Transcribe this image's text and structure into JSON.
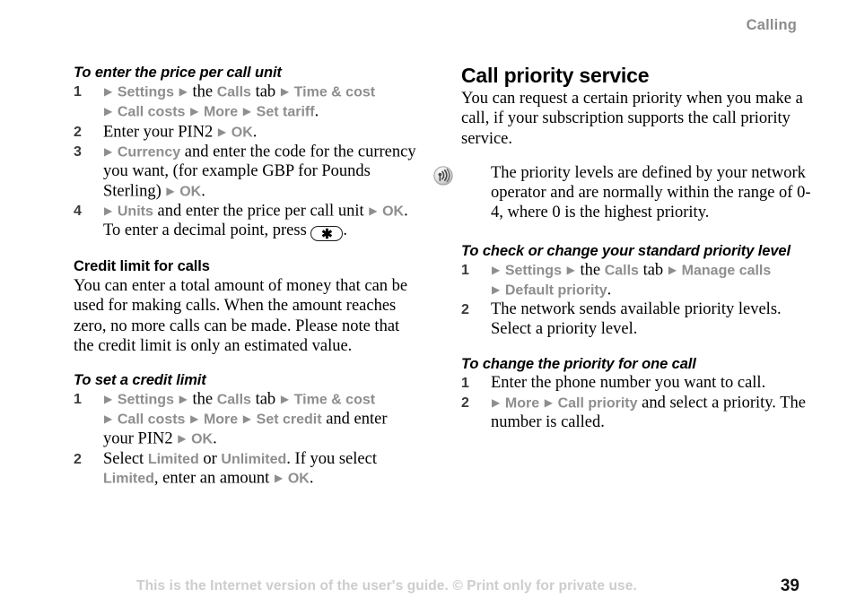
{
  "header": {
    "chapter": "Calling"
  },
  "left_column": {
    "section1": {
      "heading": "To enter the price per call unit",
      "steps": [
        {
          "num": "1",
          "lines": [
            [
              {
                "t": "arrow",
                "v": "▶"
              },
              {
                "t": "menu",
                "v": "Settings"
              },
              {
                "t": "arrow",
                "v": "▶"
              },
              {
                "t": "text",
                "v": "the"
              },
              {
                "t": "menu",
                "v": "Calls"
              },
              {
                "t": "text",
                "v": "tab"
              },
              {
                "t": "arrow",
                "v": "▶"
              },
              {
                "t": "menu",
                "v": "Time & cost"
              }
            ],
            [
              {
                "t": "arrow",
                "v": "▶"
              },
              {
                "t": "menu",
                "v": "Call costs"
              },
              {
                "t": "arrow",
                "v": "▶"
              },
              {
                "t": "menu",
                "v": "More"
              },
              {
                "t": "arrow",
                "v": "▶"
              },
              {
                "t": "menu",
                "v": "Set tariff"
              },
              {
                "t": "text",
                "v": "."
              }
            ]
          ]
        },
        {
          "num": "2",
          "lines": [
            [
              {
                "t": "text",
                "v": "Enter your PIN2"
              },
              {
                "t": "arrow",
                "v": "▶"
              },
              {
                "t": "menu",
                "v": "OK"
              },
              {
                "t": "text",
                "v": "."
              }
            ]
          ]
        },
        {
          "num": "3",
          "lines": [
            [
              {
                "t": "arrow",
                "v": "▶"
              },
              {
                "t": "menu",
                "v": "Currency"
              },
              {
                "t": "text",
                "v": "and enter the code for the currency you want, (for example GBP for Pounds Sterling)"
              },
              {
                "t": "arrow",
                "v": "▶"
              },
              {
                "t": "menu",
                "v": "OK"
              },
              {
                "t": "text",
                "v": "."
              }
            ]
          ]
        },
        {
          "num": "4",
          "lines": [
            [
              {
                "t": "arrow",
                "v": "▶"
              },
              {
                "t": "menu",
                "v": "Units"
              },
              {
                "t": "text",
                "v": "and enter the price per call unit"
              },
              {
                "t": "arrow",
                "v": "▶"
              },
              {
                "t": "menu",
                "v": "OK"
              },
              {
                "t": "text",
                "v": ". To enter a decimal point, press"
              },
              {
                "t": "keycap",
                "v": "✱"
              },
              {
                "t": "text",
                "v": "."
              }
            ]
          ]
        }
      ]
    },
    "section2": {
      "heading": "Credit limit for calls",
      "body": "You can enter a total amount of money that can be used for making calls. When the amount reaches zero, no more calls can be made. Please note that the credit limit is only an estimated value."
    },
    "section3": {
      "heading": "To set a credit limit",
      "steps": [
        {
          "num": "1",
          "lines": [
            [
              {
                "t": "arrow",
                "v": "▶"
              },
              {
                "t": "menu",
                "v": "Settings"
              },
              {
                "t": "arrow",
                "v": "▶"
              },
              {
                "t": "text",
                "v": "the"
              },
              {
                "t": "menu",
                "v": "Calls"
              },
              {
                "t": "text",
                "v": "tab"
              },
              {
                "t": "arrow",
                "v": "▶"
              },
              {
                "t": "menu",
                "v": "Time & cost"
              }
            ],
            [
              {
                "t": "arrow",
                "v": "▶"
              },
              {
                "t": "menu",
                "v": "Call costs"
              },
              {
                "t": "arrow",
                "v": "▶"
              },
              {
                "t": "menu",
                "v": "More"
              },
              {
                "t": "arrow",
                "v": "▶"
              },
              {
                "t": "menu",
                "v": "Set credit"
              },
              {
                "t": "text",
                "v": "and enter your PIN2"
              },
              {
                "t": "arrow",
                "v": "▶"
              },
              {
                "t": "menu",
                "v": "OK"
              },
              {
                "t": "text",
                "v": "."
              }
            ]
          ]
        },
        {
          "num": "2",
          "lines": [
            [
              {
                "t": "text",
                "v": "Select"
              },
              {
                "t": "menu",
                "v": "Limited"
              },
              {
                "t": "text",
                "v": "or"
              },
              {
                "t": "menu",
                "v": "Unlimited"
              },
              {
                "t": "text",
                "v": ". If you select"
              },
              {
                "t": "menu",
                "v": "Limited"
              },
              {
                "t": "text",
                "v": ", enter an amount"
              },
              {
                "t": "arrow",
                "v": "▶"
              },
              {
                "t": "menu",
                "v": "OK"
              },
              {
                "t": "text",
                "v": "."
              }
            ]
          ]
        }
      ]
    }
  },
  "right_column": {
    "section1": {
      "heading": "Call priority service",
      "body": "You can request a certain priority when you make a call, if your subscription supports the call priority service."
    },
    "note": {
      "icon": "network-signal-icon",
      "body": "The priority levels are defined by your network operator and are normally within the range of 0-4, where 0 is the highest priority."
    },
    "section2": {
      "heading": "To check or change your standard priority level",
      "steps": [
        {
          "num": "1",
          "lines": [
            [
              {
                "t": "arrow",
                "v": "▶"
              },
              {
                "t": "menu",
                "v": "Settings"
              },
              {
                "t": "arrow",
                "v": "▶"
              },
              {
                "t": "text",
                "v": "the"
              },
              {
                "t": "menu",
                "v": "Calls"
              },
              {
                "t": "text",
                "v": "tab"
              },
              {
                "t": "arrow",
                "v": "▶"
              },
              {
                "t": "menu",
                "v": "Manage calls"
              }
            ],
            [
              {
                "t": "arrow",
                "v": "▶"
              },
              {
                "t": "menu",
                "v": "Default priority"
              },
              {
                "t": "text",
                "v": "."
              }
            ]
          ]
        },
        {
          "num": "2",
          "lines": [
            [
              {
                "t": "text",
                "v": "The network sends available priority levels. Select a priority level."
              }
            ]
          ]
        }
      ]
    },
    "section3": {
      "heading": "To change the priority for one call",
      "steps": [
        {
          "num": "1",
          "lines": [
            [
              {
                "t": "text",
                "v": "Enter the phone number you want to call."
              }
            ]
          ]
        },
        {
          "num": "2",
          "lines": [
            [
              {
                "t": "arrow",
                "v": "▶"
              },
              {
                "t": "menu",
                "v": "More"
              },
              {
                "t": "arrow",
                "v": "▶"
              },
              {
                "t": "menu",
                "v": "Call priority"
              },
              {
                "t": "text",
                "v": "and select a priority. The number is called."
              }
            ]
          ]
        }
      ]
    }
  },
  "footer": {
    "notice": "This is the Internet version of the user's guide. © Print only for private use.",
    "page_number": "39"
  },
  "colors": {
    "menu_term": "#8e8e8e",
    "header_gray": "#8c8c8c",
    "footer_gray": "#cdcdcd",
    "body_black": "#000000"
  }
}
